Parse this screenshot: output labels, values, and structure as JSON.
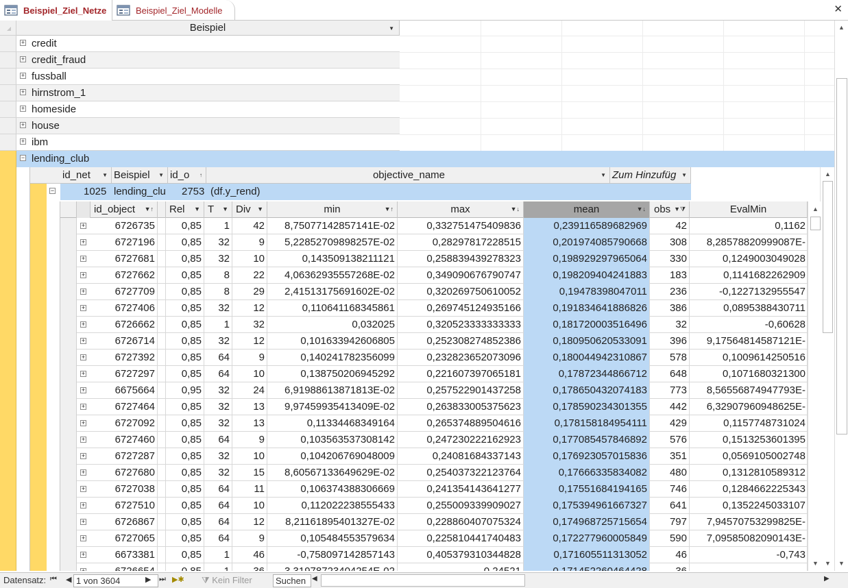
{
  "tabs": [
    {
      "label": "Beispiel_Ziel_Netze",
      "active": true
    },
    {
      "label": "Beispiel_Ziel_Modelle",
      "active": false
    }
  ],
  "outer": {
    "column_header": "Beispiel",
    "rows": [
      "credit",
      "credit_fraud",
      "fussball",
      "hirnstrom_1",
      "homeside",
      "house",
      "ibm"
    ],
    "expanded_row": "lending_club"
  },
  "level2": {
    "columns": [
      "id_net",
      "Beispiel",
      "id_o",
      "objective_name",
      "Zum Hinzufüg"
    ],
    "row": {
      "id_net": "1025",
      "beispiel": "lending_clu",
      "id_o": "2753",
      "objective_name": "(df.y_rend)"
    }
  },
  "level3": {
    "columns": [
      "id_object",
      "Rel",
      "T",
      "Div",
      "min",
      "max",
      "mean",
      "obs",
      "EvalMin"
    ],
    "rows": [
      [
        "6726735",
        "0,85",
        "1",
        "42",
        "8,75077142857141E-02",
        "0,332751475409836",
        "0,239116589682969",
        "42",
        "0,1162"
      ],
      [
        "6727196",
        "0,85",
        "32",
        "9",
        "5,22852709898257E-02",
        "0,28297817228515",
        "0,201974085790668",
        "308",
        "8,28578820999087E-"
      ],
      [
        "6727681",
        "0,85",
        "32",
        "10",
        "0,143509138211121",
        "0,258839439278323",
        "0,198929297965064",
        "330",
        "0,1249003049028"
      ],
      [
        "6727662",
        "0,85",
        "8",
        "22",
        "4,06362935557268E-02",
        "0,349090676790747",
        "0,198209404241883",
        "183",
        "0,1141682262909"
      ],
      [
        "6727709",
        "0,85",
        "8",
        "29",
        "2,41513175691602E-02",
        "0,320269750610052",
        "0,19478398047011",
        "236",
        "-0,1227132955547"
      ],
      [
        "6727406",
        "0,85",
        "32",
        "12",
        "0,110641168345861",
        "0,269745124935166",
        "0,191834641886826",
        "386",
        "0,0895388430711"
      ],
      [
        "6726662",
        "0,85",
        "1",
        "32",
        "0,032025",
        "0,320523333333333",
        "0,181720003516496",
        "32",
        "-0,60628"
      ],
      [
        "6726714",
        "0,85",
        "32",
        "12",
        "0,101633942606805",
        "0,252308274852386",
        "0,180950620533091",
        "396",
        "9,17564814587121E-"
      ],
      [
        "6727392",
        "0,85",
        "64",
        "9",
        "0,140241782356099",
        "0,232823652073096",
        "0,180044942310867",
        "578",
        "0,1009614250516"
      ],
      [
        "6727297",
        "0,85",
        "64",
        "10",
        "0,138750206945292",
        "0,221607397065181",
        "0,17872344866712",
        "648",
        "0,1071680321300"
      ],
      [
        "6675664",
        "0,95",
        "32",
        "24",
        "6,91988613871813E-02",
        "0,257522901437258",
        "0,178650432074183",
        "773",
        "8,56556874947793E-"
      ],
      [
        "6727464",
        "0,85",
        "32",
        "13",
        "9,97459935413409E-02",
        "0,263833005375623",
        "0,178590234301355",
        "442",
        "6,32907960948625E-"
      ],
      [
        "6727092",
        "0,85",
        "32",
        "13",
        "0,11334468349164",
        "0,265374889504616",
        "0,178158184954111",
        "429",
        "0,1157748731024"
      ],
      [
        "6727460",
        "0,85",
        "64",
        "9",
        "0,103563537308142",
        "0,247230222162923",
        "0,177085457846892",
        "576",
        "0,1513253601395"
      ],
      [
        "6727287",
        "0,85",
        "32",
        "10",
        "0,104206769048009",
        "0,24081684337143",
        "0,176923057015836",
        "351",
        "0,0569105002748"
      ],
      [
        "6727680",
        "0,85",
        "32",
        "15",
        "8,60567133649629E-02",
        "0,254037322123764",
        "0,17666335834082",
        "480",
        "0,1312810589312"
      ],
      [
        "6727038",
        "0,85",
        "64",
        "11",
        "0,106374388306669",
        "0,241354143641277",
        "0,17551684194165",
        "746",
        "0,1284662225343"
      ],
      [
        "6727510",
        "0,85",
        "64",
        "10",
        "0,112022238555433",
        "0,255009339909027",
        "0,175394961667327",
        "641",
        "0,1352245033107"
      ],
      [
        "6726867",
        "0,85",
        "64",
        "12",
        "8,21161895401327E-02",
        "0,228860407075324",
        "0,174968725715654",
        "797",
        "7,94570753299825E-"
      ],
      [
        "6727065",
        "0,85",
        "64",
        "9",
        "0,105484553579634",
        "0,225810441740483",
        "0,172277960005849",
        "590",
        "7,09585082090143E-"
      ],
      [
        "6673381",
        "0,85",
        "1",
        "46",
        "-0,758097142857143",
        "0,405379310344828",
        "0,171605511313052",
        "46",
        "-0,743"
      ],
      [
        "6726654",
        "0,85",
        "1",
        "36",
        "3,31978723404254E-02",
        "0,24521",
        "0,171452260464428",
        "36",
        ""
      ]
    ]
  },
  "navigation": {
    "label": "Datensatz:",
    "record": "1 von 3604",
    "filter": "Kein Filter",
    "search": "Suchen"
  },
  "colors": {
    "accent_yellow": "#ffd966",
    "selection_blue": "#bcd9f5",
    "tab_text": "#a3262a"
  }
}
